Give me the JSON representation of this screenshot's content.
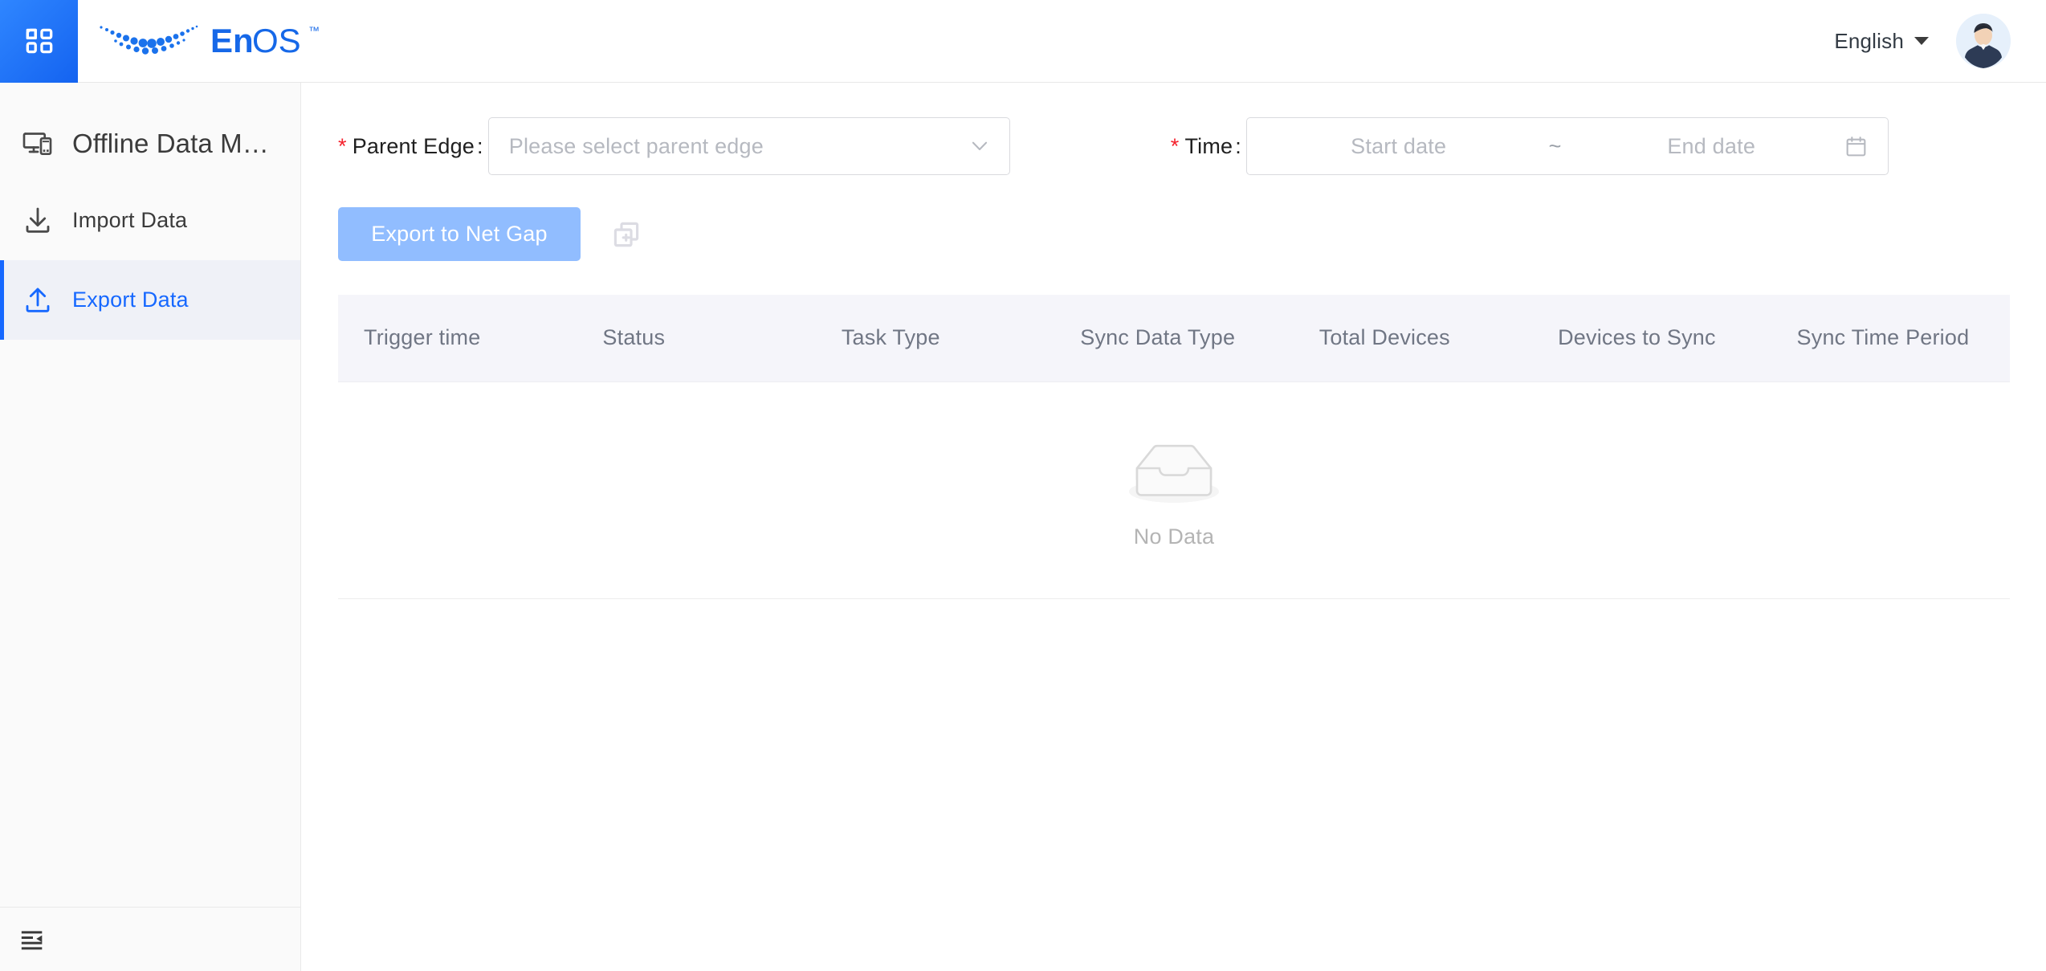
{
  "header": {
    "app_grid_icon": "grid-apps-icon",
    "brand_mark_icon": "enos-dots-logo-icon",
    "brand_name": "EnOS",
    "brand_trademark": "™",
    "language": "English",
    "language_caret_icon": "caret-down-icon",
    "avatar_icon": "user-avatar"
  },
  "sidebar": {
    "title": "Offline Data M…",
    "title_icon": "devices-icon",
    "items": [
      {
        "label": "Import Data",
        "icon": "download-icon",
        "active": false
      },
      {
        "label": "Export Data",
        "icon": "upload-icon",
        "active": true
      }
    ],
    "collapse_icon": "menu-fold-icon"
  },
  "filters": {
    "parent_edge": {
      "required_mark": "*",
      "label": "Parent Edge",
      "colon": ":",
      "placeholder": "Please select parent edge",
      "value": "",
      "chevron_icon": "chevron-down-icon"
    },
    "time": {
      "required_mark": "*",
      "label": "Time",
      "colon": ":",
      "start_placeholder": "Start date",
      "separator": "~",
      "end_placeholder": "End date",
      "start_value": "",
      "end_value": "",
      "calendar_icon": "calendar-icon"
    }
  },
  "actions": {
    "export_button": "Export to Net Gap",
    "export_button_disabled": true,
    "copy_icon": "copy-add-icon"
  },
  "table": {
    "columns": [
      "Trigger time",
      "Status",
      "Task Type",
      "Sync Data Type",
      "Total Devices",
      "Devices to Sync",
      "Sync Time Period"
    ],
    "rows": [],
    "empty_text": "No Data",
    "empty_icon": "empty-box-icon"
  },
  "colors": {
    "accent_blue": "#1668ff",
    "tile_blue": "#2f86ff",
    "button_disabled_blue": "#91bdff",
    "required_red": "#f5222d",
    "sidebar_bg": "#fafafa",
    "table_header_bg": "#f5f5fa",
    "placeholder_grey": "#b6b9c0"
  }
}
